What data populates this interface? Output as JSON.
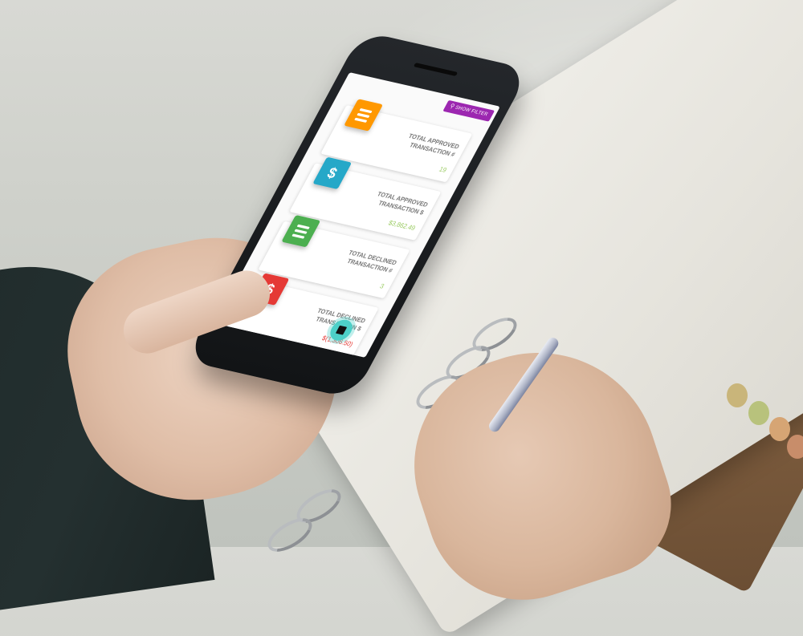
{
  "app": {
    "filter_button_label": "SHOW FILTER",
    "filter_icon": "search-icon",
    "fab_icon": "chat-icon"
  },
  "cards": [
    {
      "label": "TOTAL APPROVED TRANSACTION #",
      "value": "19",
      "icon": "list-icon",
      "color": "#ff9800",
      "value_color": "#9ccc65"
    },
    {
      "label": "TOTAL APPROVED TRANSACTION $",
      "value": "$3,862.49",
      "icon": "dollar-icon",
      "color": "#26a8c8",
      "value_color": "#9ccc65"
    },
    {
      "label": "TOTAL DECLINED TRANSACTION #",
      "value": "3",
      "icon": "list-icon",
      "color": "#4caf50",
      "value_color": "#9ccc65"
    },
    {
      "label": "TOTAL DECLINED TRANSACTION $",
      "value": "$(1,306.50)",
      "icon": "dollar-icon",
      "color": "#e53935",
      "value_color": "#e53935"
    }
  ]
}
